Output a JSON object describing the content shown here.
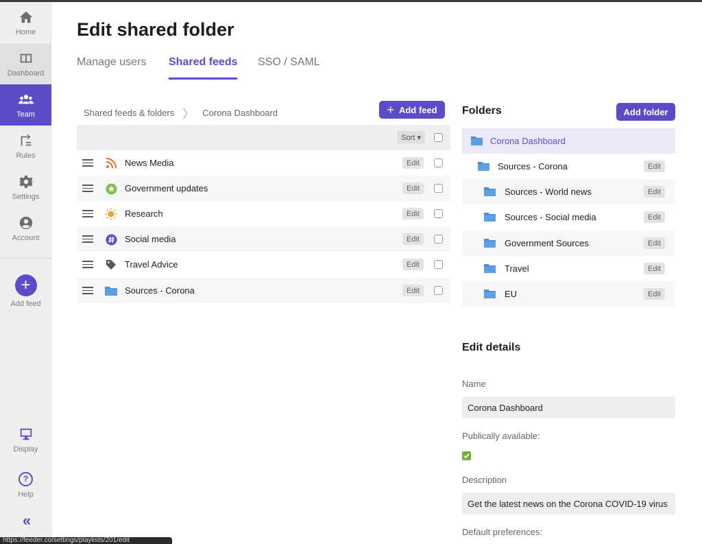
{
  "sidebar": {
    "home": "Home",
    "dashboard": "Dashboard",
    "team": "Team",
    "rules": "Rules",
    "settings": "Settings",
    "account": "Account",
    "add_feed": "Add feed",
    "display": "Display",
    "help": "Help",
    "help_symbol": "?",
    "collapse_symbol": "«"
  },
  "page": {
    "title": "Edit shared folder",
    "tabs": [
      {
        "label": "Manage users",
        "active": false
      },
      {
        "label": "Shared feeds",
        "active": true
      },
      {
        "label": "SSO / SAML",
        "active": false
      }
    ]
  },
  "feeds": {
    "breadcrumb": [
      "Shared feeds & folders",
      "Corona Dashboard"
    ],
    "breadcrumb_sep": "〉",
    "add_feed_label": "Add feed",
    "sort_label": "Sort ▾",
    "edit_label": "Edit",
    "items": [
      {
        "label": "News Media",
        "icon": "rss-icon"
      },
      {
        "label": "Government updates",
        "icon": "star-badge-icon"
      },
      {
        "label": "Research",
        "icon": "lightbulb-icon"
      },
      {
        "label": "Social media",
        "icon": "hashtag-icon"
      },
      {
        "label": "Travel Advice",
        "icon": "tag-icon"
      },
      {
        "label": "Sources - Corona",
        "icon": "folder-icon"
      }
    ]
  },
  "folders": {
    "title": "Folders",
    "add_folder_label": "Add folder",
    "edit_label": "Edit",
    "items": [
      {
        "label": "Corona Dashboard",
        "level": 0,
        "selected": true
      },
      {
        "label": "Sources - Corona",
        "level": 1
      },
      {
        "label": "Sources - World news",
        "level": 2
      },
      {
        "label": "Sources - Social media",
        "level": 2
      },
      {
        "label": "Government Sources",
        "level": 2
      },
      {
        "label": "Travel",
        "level": 2
      },
      {
        "label": "EU",
        "level": 2
      }
    ]
  },
  "details": {
    "title": "Edit details",
    "name_label": "Name",
    "name_value": "Corona Dashboard",
    "public_label": "Publically available:",
    "public_checked": true,
    "description_label": "Description",
    "description_value": "Get the latest news on the Corona COVID-19 virus",
    "preferences_label": "Default preferences:"
  },
  "status_bar": {
    "url": "https://feeder.co/settings/playlists/201/edit"
  },
  "colors": {
    "accent": "#5b4dc9",
    "rss": "#e8692c",
    "star_badge": "#7cc04a",
    "lightbulb": "#f0a030",
    "folder": "#4a90d9",
    "check": "#6fb23a"
  }
}
